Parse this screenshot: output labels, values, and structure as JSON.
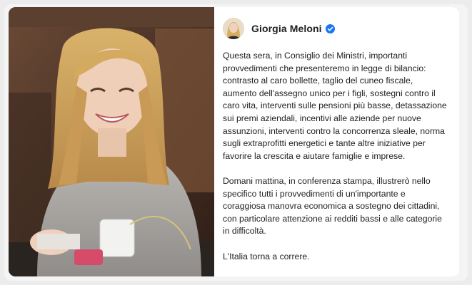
{
  "post": {
    "author": "Giorgia Meloni",
    "verified_icon": "verified-badge-icon",
    "paragraphs": [
      "Questa sera, in Consiglio dei Ministri, importanti provvedimenti che presenteremo in legge di bilancio: contrasto al caro bollette, taglio del cuneo fiscale, aumento dell'assegno unico per i figli, sostegni contro il caro vita, interventi sulle pensioni più basse, detassazione sui premi aziendali, incentivi alle aziende per nuove assunzioni, interventi contro la concorrenza sleale, norma sugli extraprofitti energetici e tante altre iniziative per favorire la crescita e aiutare famiglie e imprese.",
      "Domani mattina, in conferenza stampa, illustrerò nello specifico tutti i provvedimenti di un'importante e coraggiosa manovra economica a sostegno dei cittadini, con particolare attenzione ai redditi bassi e alle categorie in difficoltà.",
      "L'Italia torna a correre."
    ]
  },
  "colors": {
    "verified": "#1877f2",
    "text": "#1c1e21",
    "card": "#ffffff"
  }
}
